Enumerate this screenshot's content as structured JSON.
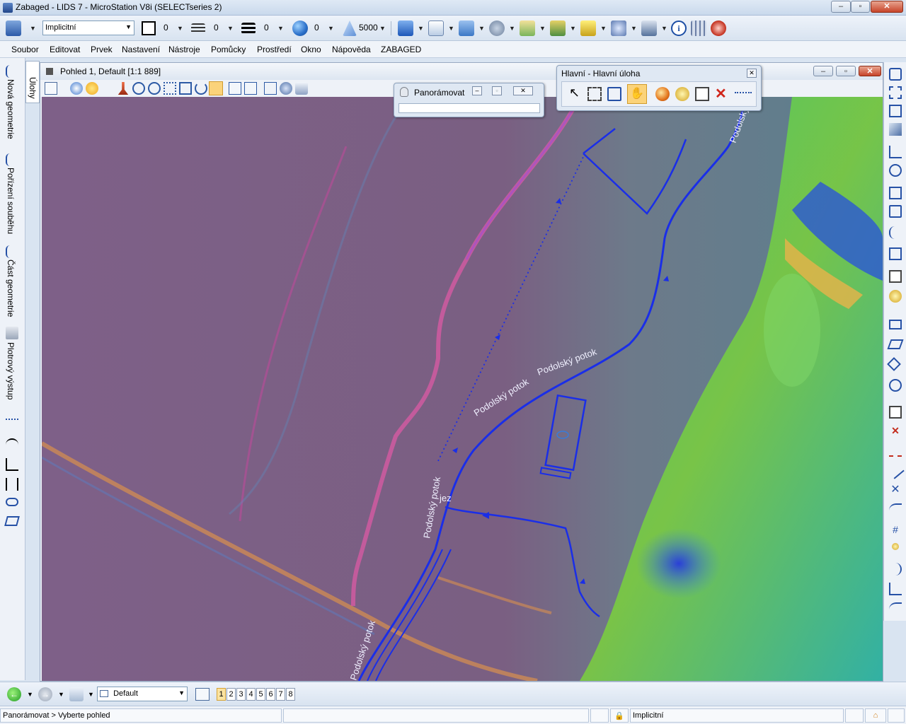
{
  "window": {
    "title": "Zabaged - LIDS 7 - MicroStation V8i (SELECTseries 2)",
    "minimize": "–",
    "maximize": "▫",
    "close": "✕"
  },
  "attributes": {
    "level": "Implicitní",
    "color": "0",
    "style": "0",
    "weight": "0",
    "transparency": "0",
    "scale": "5000"
  },
  "menu": [
    "Soubor",
    "Editovat",
    "Prvek",
    "Nastavení",
    "Nástroje",
    "Pomůcky",
    "Prostředí",
    "Okno",
    "Nápověda",
    "ZABAGED"
  ],
  "tasks": {
    "tab": "Úlohy",
    "items": [
      "Nová geometrie",
      "Pořízení souběhu",
      "Část geometrie",
      "Plotrový výstup"
    ]
  },
  "view": {
    "title": "Pohled 1, Default [1:1 889]"
  },
  "pan_dialog": {
    "title": "Panorámovat"
  },
  "main_toolbox": {
    "title": "Hlavní - Hlavní úloha"
  },
  "map_labels": {
    "stream_1": "Podolský potok",
    "stream_2": "Podolský potok",
    "stream_3": "Podolský potok",
    "stream_4": "Podolský potok",
    "stream_5": "Podolský",
    "weir": "jez"
  },
  "bottom": {
    "view_group": "Default",
    "view_numbers": [
      "1",
      "2",
      "3",
      "4",
      "5",
      "6",
      "7",
      "8"
    ],
    "active_view": "1"
  },
  "status": {
    "prompt": "Panorámovat > Vyberte pohled",
    "level": "Implicitní"
  },
  "colors": {
    "stream": "#1a2ee8",
    "terrain_base": "#7a5f82",
    "active_tool": "#fbd37a"
  }
}
